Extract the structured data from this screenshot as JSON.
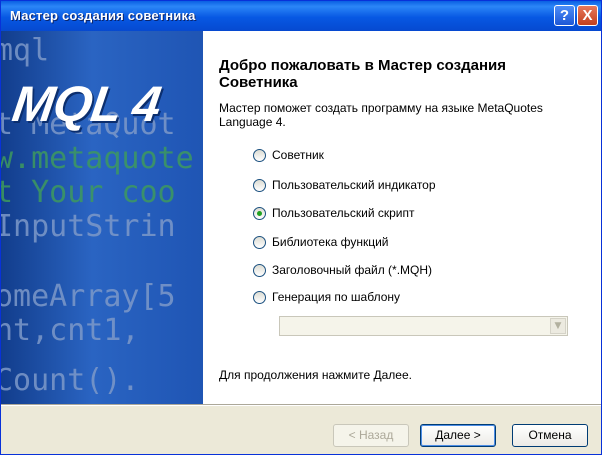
{
  "window": {
    "title": "Мастер создания советника",
    "help_label": "?",
    "close_label": "X"
  },
  "side": {
    "logo": "MQL 4",
    "code_lines": [
      "mql",
      "t  MetaQuot",
      "w.metaquote",
      "t Your coo",
      "InputStrin",
      "",
      "omeArray[5",
      "nt,cnt1,",
      "",
      "Count()."
    ]
  },
  "main": {
    "heading": "Добро пожаловать в Мастер создания Советника",
    "description": "Мастер поможет создать программу на языке MetaQuotes Language 4.",
    "options": [
      {
        "label": "Советник",
        "selected": false
      },
      {
        "label": "Пользовательский индикатор",
        "selected": false
      },
      {
        "label": "Пользовательский скрипт",
        "selected": true
      },
      {
        "label": "Библиотека функций",
        "selected": false
      },
      {
        "label": "Заголовочный файл (*.MQH)",
        "selected": false
      },
      {
        "label": "Генерация по шаблону",
        "selected": false
      }
    ],
    "template_value": "",
    "footer_hint": "Для продолжения нажмите Далее."
  },
  "buttons": {
    "back": "< Назад",
    "next": "Далее >",
    "cancel": "Отмена"
  }
}
